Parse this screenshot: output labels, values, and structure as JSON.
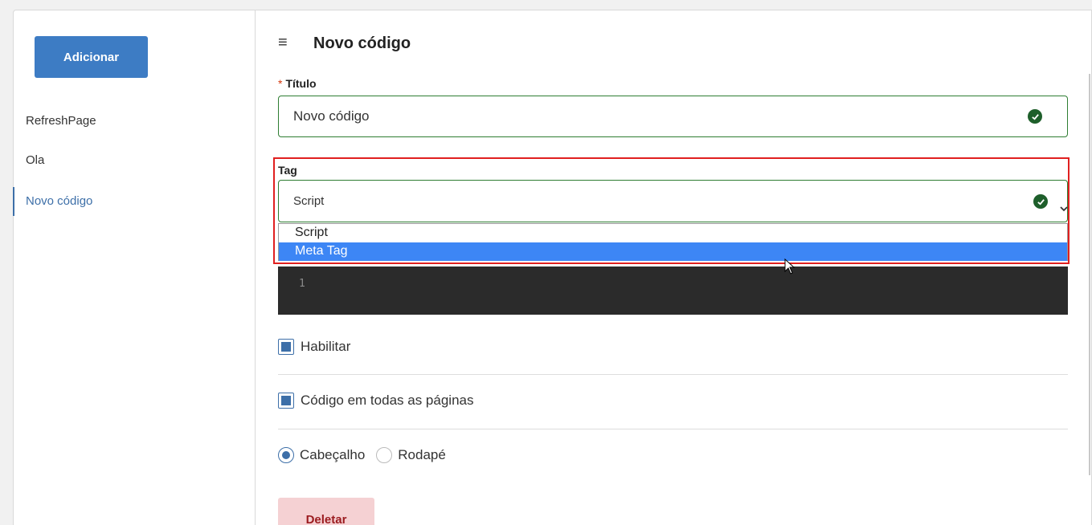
{
  "sidebar": {
    "add_button": "Adicionar",
    "items": [
      {
        "label": "RefreshPage"
      },
      {
        "label": "Ola"
      },
      {
        "label": "Novo código"
      }
    ]
  },
  "header": {
    "title": "Novo código"
  },
  "form": {
    "title_field": {
      "required_mark": "*",
      "label": "Título",
      "value": "Novo código"
    },
    "tag_field": {
      "label": "Tag",
      "value": "Script",
      "options": [
        "Script",
        "Meta Tag"
      ],
      "highlighted_option": "Meta Tag"
    },
    "editor": {
      "line_number": "1"
    },
    "enable_label": "Habilitar",
    "all_pages_label": "Código em todas as páginas",
    "position": {
      "options": [
        "Cabeçalho",
        "Rodapé"
      ],
      "selected": "Cabeçalho"
    },
    "delete_button": "Deletar"
  },
  "colors": {
    "primary": "#3d7cc4",
    "valid_border": "#2e7d32",
    "highlight_box": "#e02020",
    "selected_option": "#3d86f5",
    "delete_bg": "#f5d1d3",
    "delete_text": "#9b1b1f"
  }
}
